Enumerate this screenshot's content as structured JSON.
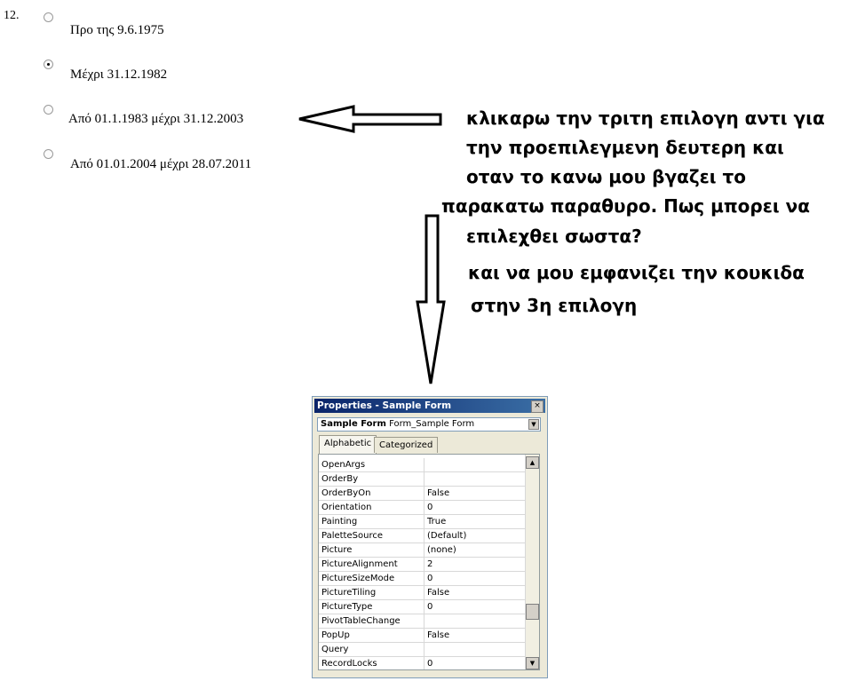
{
  "question": {
    "number": "12.",
    "options": [
      {
        "label": "Προ της 9.6.1975",
        "selected": false
      },
      {
        "label": "Μέχρι 31.12.1982",
        "selected": true
      },
      {
        "label": "Από 01.1.1983 μέχρι 31.12.2003",
        "selected": false
      },
      {
        "label": "Από 01.01.2004 μέχρι 28.07.2011",
        "selected": false
      }
    ]
  },
  "annotation": {
    "lines": [
      "κλικαρω την τριτη επιλογη αντι για",
      "την προεπιλεγμενη δευτερη και",
      "οταν το κανω μου βγαζει το",
      "παρακατω παραθυρο. Πως μπορει να",
      "επιλεχθει σωστα?",
      "και να μου εμφανιζει την κουκιδα",
      "στην 3η επιλογη"
    ]
  },
  "properties_window": {
    "title": "Properties - Sample Form",
    "close_glyph": "×",
    "selector_bold": "Sample Form",
    "selector_value": "Form_Sample Form",
    "tabs": [
      "Alphabetic",
      "Categorized"
    ],
    "rows": [
      {
        "name": "OpenArgs",
        "value": ""
      },
      {
        "name": "OrderBy",
        "value": ""
      },
      {
        "name": "OrderByOn",
        "value": "False"
      },
      {
        "name": "Orientation",
        "value": "0"
      },
      {
        "name": "Painting",
        "value": "True"
      },
      {
        "name": "PaletteSource",
        "value": "(Default)"
      },
      {
        "name": "Picture",
        "value": "(none)"
      },
      {
        "name": "PictureAlignment",
        "value": "2"
      },
      {
        "name": "PictureSizeMode",
        "value": "0"
      },
      {
        "name": "PictureTiling",
        "value": "False"
      },
      {
        "name": "PictureType",
        "value": "0"
      },
      {
        "name": "PivotTableChange",
        "value": ""
      },
      {
        "name": "PopUp",
        "value": "False"
      },
      {
        "name": "Query",
        "value": ""
      },
      {
        "name": "RecordLocks",
        "value": "0"
      }
    ]
  }
}
